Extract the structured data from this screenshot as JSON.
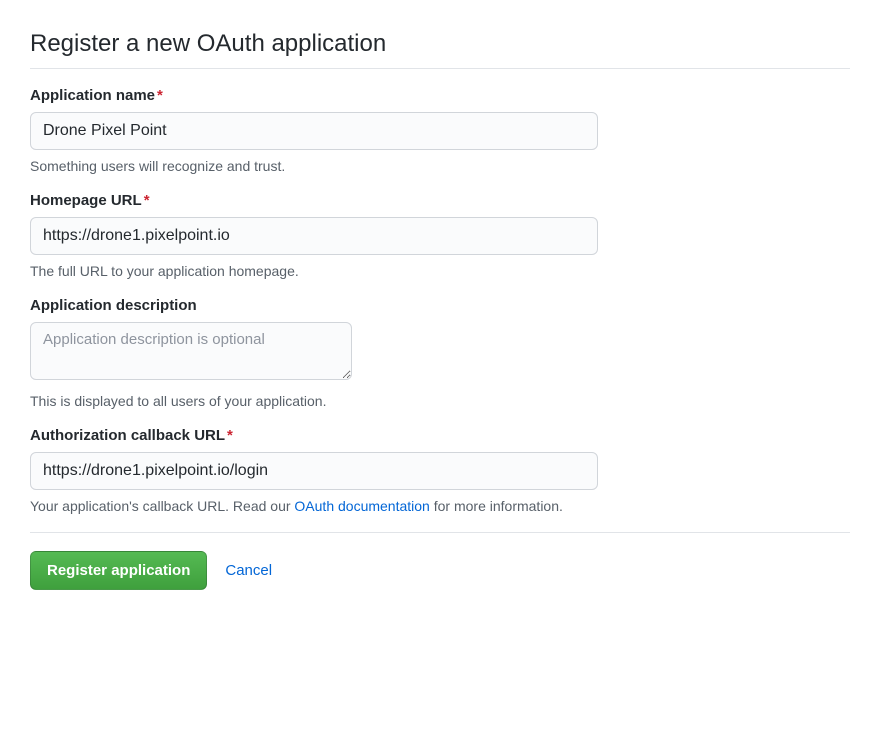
{
  "title": "Register a new OAuth application",
  "fields": {
    "name": {
      "label": "Application name",
      "required": true,
      "value": "Drone Pixel Point",
      "hint": "Something users will recognize and trust."
    },
    "homepage": {
      "label": "Homepage URL",
      "required": true,
      "value": "https://drone1.pixelpoint.io",
      "hint": "The full URL to your application homepage."
    },
    "description": {
      "label": "Application description",
      "required": false,
      "value": "",
      "placeholder": "Application description is optional",
      "hint": "This is displayed to all users of your application."
    },
    "callback": {
      "label": "Authorization callback URL",
      "required": true,
      "value": "https://drone1.pixelpoint.io/login",
      "hint_before": "Your application's callback URL. Read our ",
      "hint_link": "OAuth documentation",
      "hint_after": " for more information."
    }
  },
  "actions": {
    "submit": "Register application",
    "cancel": "Cancel"
  }
}
